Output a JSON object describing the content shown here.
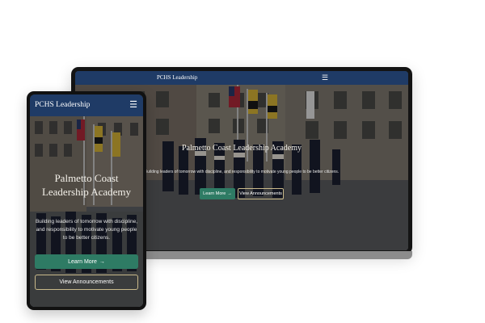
{
  "desktop": {
    "nav": {
      "brand": "PCHS Leadership",
      "menu_icon": "hamburger-icon",
      "menu_glyph": "☰"
    },
    "hero": {
      "title": "Palmetto Coast Leadership Academy",
      "tagline": "Building leaders of tomorrow with discipline, and responsibility to motivate young people to be better citizens.",
      "primary_button": "Learn More",
      "primary_arrow": "→",
      "secondary_button": "View Announcements"
    }
  },
  "mobile": {
    "nav": {
      "brand": "PCHS Leadership",
      "menu_icon": "hamburger-icon",
      "menu_glyph": "☰"
    },
    "hero": {
      "title": "Palmetto Coast Leadership Academy",
      "tagline": "Building leaders of tomorrow with discipline, and responsibility to motivate young people to be better citizens.",
      "primary_button": "Learn More",
      "primary_arrow": "→",
      "secondary_button": "View Announcements"
    }
  },
  "colors": {
    "nav_background": "#1f3b66",
    "primary_button": "#2e7b64",
    "outline_border": "#c9b98a"
  }
}
